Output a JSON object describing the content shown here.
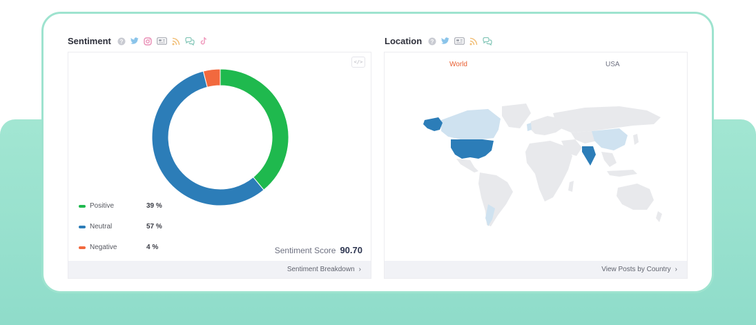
{
  "sentiment": {
    "title": "Sentiment",
    "legend": [
      {
        "label": "Positive",
        "pct": "39 %",
        "color": "#1fb94e"
      },
      {
        "label": "Neutral",
        "pct": "57 %",
        "color": "#2c7db8"
      },
      {
        "label": "Negative",
        "pct": "4 %",
        "color": "#f2693e"
      }
    ],
    "score_label": "Sentiment Score",
    "score_value": "90.70",
    "footer_link": "Sentiment Breakdown",
    "embed_icon": "</>"
  },
  "location": {
    "title": "Location",
    "tabs": [
      "World",
      "USA"
    ],
    "active_tab": "World",
    "footer_link": "View Posts by Country"
  },
  "chart_data": {
    "type": "pie",
    "categories": [
      "Positive",
      "Neutral",
      "Negative"
    ],
    "values": [
      39,
      57,
      4
    ],
    "colors": [
      "#1fb94e",
      "#2c7db8",
      "#f2693e"
    ],
    "title": ""
  },
  "colors": {
    "accent_teal": "#9ee3cf",
    "active_tab": "#e85d2f"
  }
}
